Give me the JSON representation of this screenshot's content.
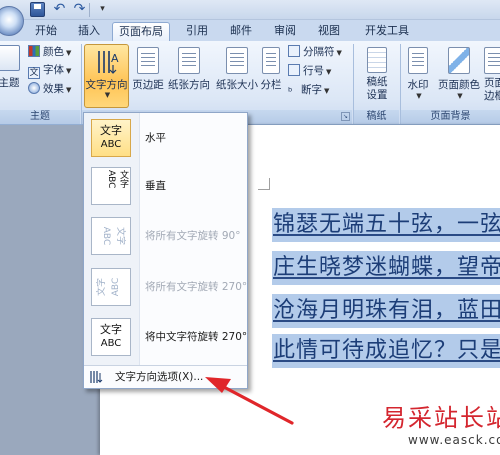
{
  "tabs": [
    {
      "label": "开始",
      "active": false
    },
    {
      "label": "插入",
      "active": false
    },
    {
      "label": "页面布局",
      "active": true
    },
    {
      "label": "引用",
      "active": false
    },
    {
      "label": "邮件",
      "active": false
    },
    {
      "label": "审阅",
      "active": false
    },
    {
      "label": "视图",
      "active": false
    },
    {
      "label": "开发工具",
      "active": false
    }
  ],
  "ribbon": {
    "themes_group": {
      "label": "主题",
      "themes_button": "主题",
      "colors": "颜色",
      "fonts": "字体",
      "effects": "效果"
    },
    "page_setup_group": {
      "text_direction": "文字方向",
      "margins": "页边距",
      "orientation": "纸张方向",
      "size": "纸张大小",
      "columns": "分栏",
      "breaks": "分隔符",
      "line_numbers": "行号",
      "hyphenation": "断字"
    },
    "draft_paper_group": {
      "label": "稿纸",
      "settings_line1": "稿纸",
      "settings_line2": "设置"
    },
    "page_background_group": {
      "label": "页面背景",
      "watermark": "水印",
      "page_color": "页面颜色",
      "page_borders_line1": "页面",
      "page_borders_line2": "边框"
    }
  },
  "dropdown": {
    "items": [
      {
        "label": "水平",
        "thumb_line1": "文字",
        "thumb_line2": "ABC",
        "enabled": true,
        "selected": true
      },
      {
        "label": "垂直",
        "thumb_line1": "文字ABC",
        "enabled": true,
        "selected": false
      },
      {
        "label": "将所有文字旋转 90°",
        "thumb_line1": "文字",
        "thumb_line2": "ABC",
        "enabled": false,
        "selected": false
      },
      {
        "label": "将所有文字旋转 270°",
        "thumb_line1": "文字",
        "thumb_line2": "ABC",
        "enabled": false,
        "selected": false
      },
      {
        "label": "将中文字符旋转 270°",
        "thumb_line1": "文字",
        "thumb_line2": "ABC",
        "enabled": true,
        "selected": false
      }
    ],
    "options_label": "文字方向选项(X)..."
  },
  "document": {
    "lines": [
      "锦瑟无端五十弦，一弦",
      "庄生晓梦迷蝴蝶，望帝",
      "沧海月明珠有泪，蓝田",
      "此情可待成追忆？只是"
    ]
  },
  "watermark": {
    "title": "易采站长站",
    "url": "www.easck.com"
  },
  "colors": {
    "accent": "#ffc455",
    "selection": "#b3cbea",
    "arrow": "#e0262a",
    "watermark_red": "#d4262f"
  }
}
